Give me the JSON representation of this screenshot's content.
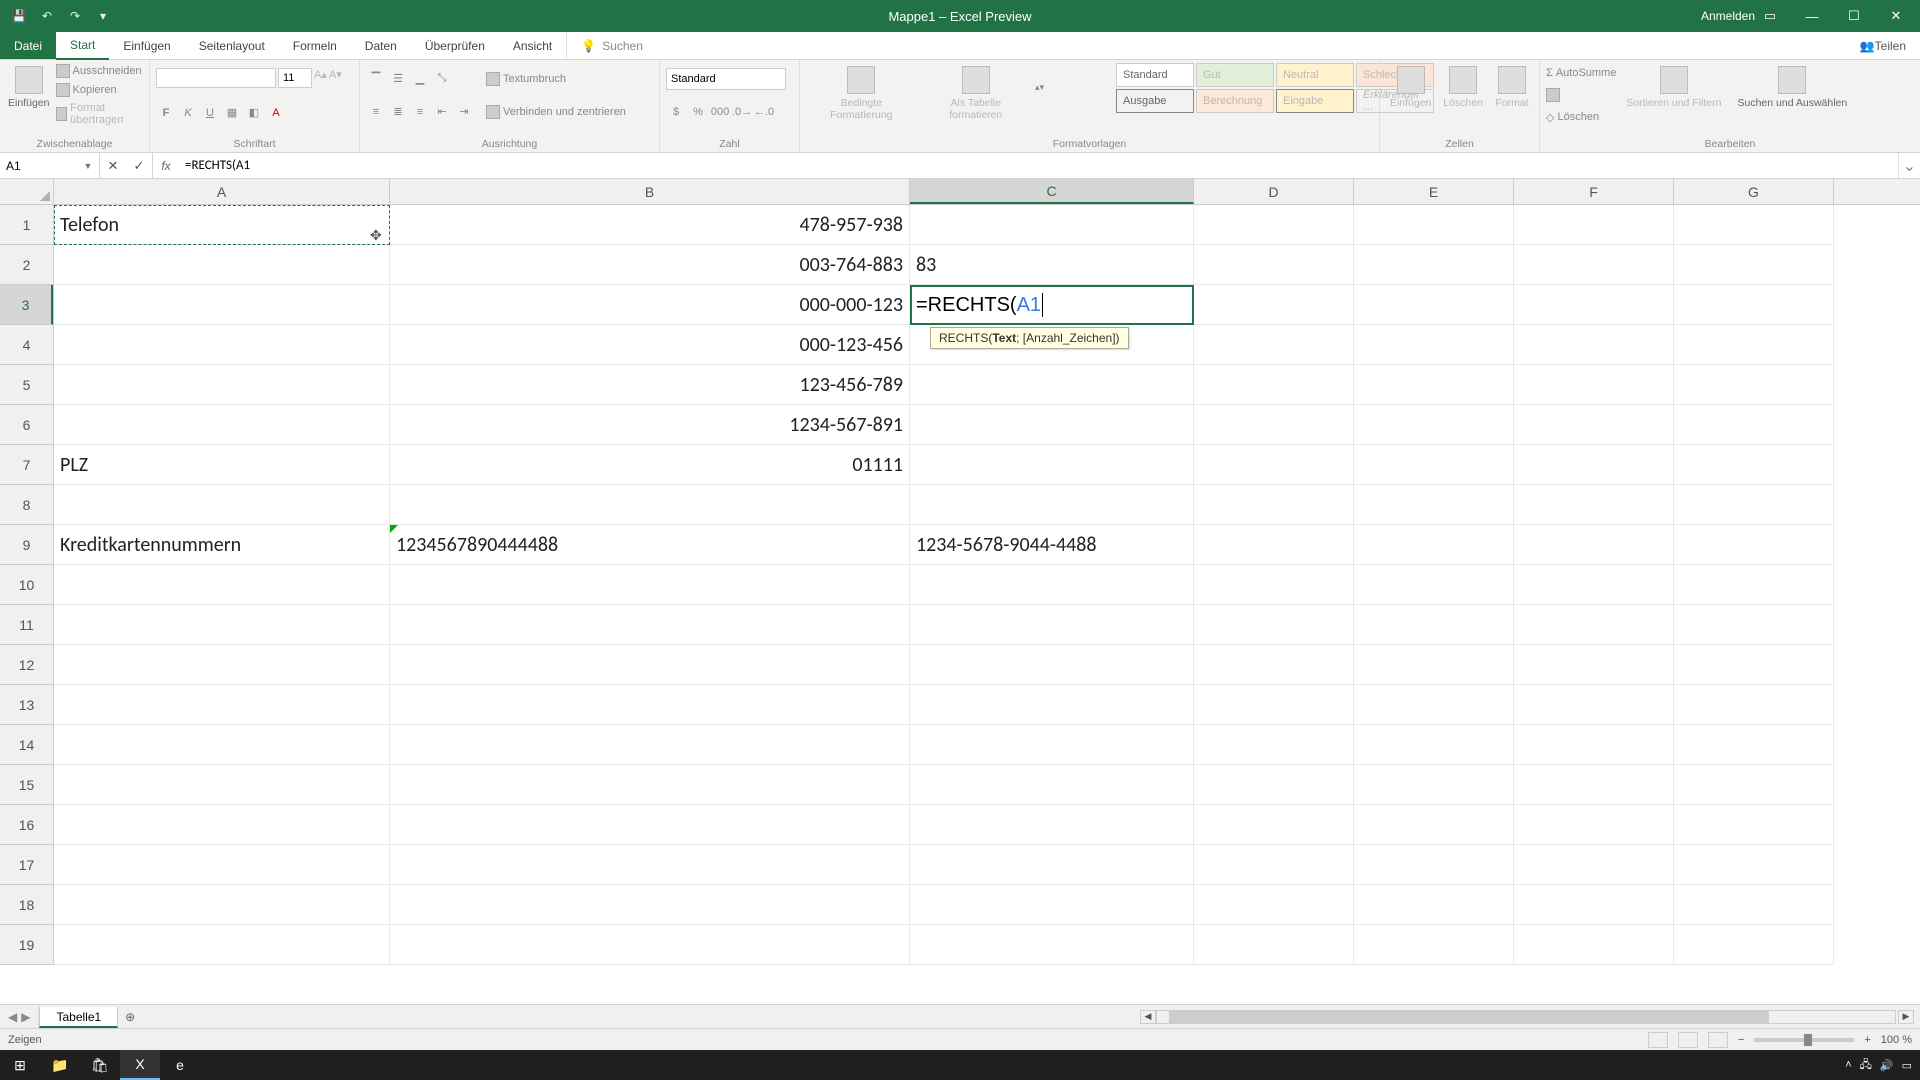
{
  "titlebar": {
    "title": "Mappe1 – Excel Preview",
    "signin": "Anmelden"
  },
  "tabs": {
    "file": "Datei",
    "home": "Start",
    "insert": "Einfügen",
    "layout": "Seitenlayout",
    "formulas": "Formeln",
    "data": "Daten",
    "review": "Überprüfen",
    "view": "Ansicht",
    "search": "Suchen",
    "share": "Teilen"
  },
  "ribbon": {
    "clipboard": {
      "paste": "Einfügen",
      "cut": "Ausschneiden",
      "copy": "Kopieren",
      "format": "Format übertragen",
      "label": "Zwischenablage"
    },
    "font": {
      "name": "",
      "size": "11",
      "label": "Schriftart"
    },
    "align": {
      "wrap": "Textumbruch",
      "merge": "Verbinden und zentrieren",
      "label": "Ausrichtung"
    },
    "number": {
      "format": "Standard",
      "label": "Zahl"
    },
    "styles": {
      "cond": "Bedingte Formatierung",
      "table": "Als Tabelle formatieren",
      "s1": "Standard",
      "s2": "Gut",
      "s3": "Neutral",
      "s4": "Schlecht",
      "s5": "Ausgabe",
      "s6": "Berechnung",
      "s7": "Eingabe",
      "s8": "Erklärender …",
      "label": "Formatvorlagen"
    },
    "cells": {
      "insert": "Einfügen",
      "delete": "Löschen",
      "format": "Format",
      "label": "Zellen"
    },
    "edit": {
      "sum": "AutoSumme",
      "fill": "",
      "clear": "Löschen",
      "sort": "Sortieren und Filtern",
      "find": "Suchen und Auswählen",
      "label": "Bearbeiten"
    }
  },
  "namebox": "A1",
  "formula": "=RECHTS(A1",
  "colheads": [
    "A",
    "B",
    "C",
    "D",
    "E",
    "F",
    "G"
  ],
  "rows": [
    "1",
    "2",
    "3",
    "4",
    "5",
    "6",
    "7",
    "8",
    "9",
    "10",
    "11",
    "12",
    "13",
    "14",
    "15",
    "16",
    "17",
    "18",
    "19"
  ],
  "cells": {
    "A1": "Telefon",
    "B1": "478-957-938",
    "B2": "003-764-883",
    "C2": "83",
    "B3": "000-000-123",
    "B4": "000-123-456",
    "B5": "123-456-789",
    "B6": "1234-567-891",
    "A7": "PLZ",
    "B7": "01111",
    "A9": "Kreditkartennummern",
    "B9": "1234567890444488",
    "C9": "1234-5678-9044-4488"
  },
  "edit": {
    "prefix": "=RECHTS(",
    "ref": "A1",
    "tooltip_fn": "RECHTS(",
    "tooltip_bold": "Text",
    "tooltip_rest": "; [Anzahl_Zeichen])"
  },
  "sheet": {
    "name": "Tabelle1"
  },
  "status": {
    "mode": "Zeigen",
    "zoom": "100 %"
  },
  "tray": {
    "time": ""
  }
}
